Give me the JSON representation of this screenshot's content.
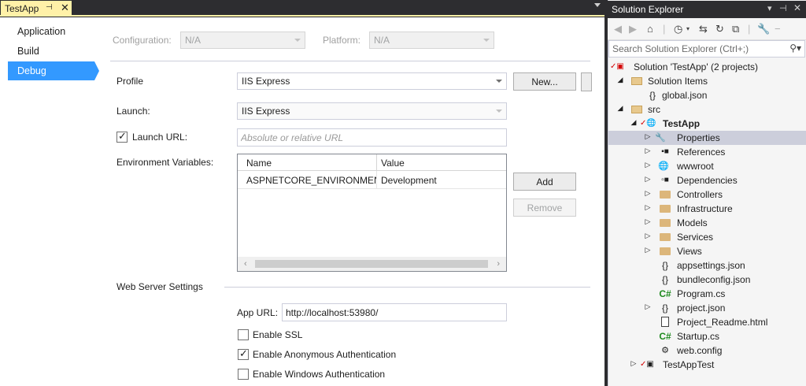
{
  "document": {
    "tab_title": "TestApp",
    "pin_glyph": "⊣",
    "close_glyph": "✕"
  },
  "nav": {
    "items": [
      {
        "label": "Application",
        "selected": false
      },
      {
        "label": "Build",
        "selected": false
      },
      {
        "label": "Debug",
        "selected": true
      }
    ]
  },
  "config": {
    "configuration_label": "Configuration:",
    "configuration_value": "N/A",
    "platform_label": "Platform:",
    "platform_value": "N/A"
  },
  "debug": {
    "profile_label": "Profile",
    "profile_value": "IIS Express",
    "new_button": "New...",
    "launch_label": "Launch:",
    "launch_value": "IIS Express",
    "launch_url_label": "Launch URL:",
    "launch_url_checked": true,
    "launch_url_placeholder": "Absolute or relative URL",
    "env_vars_label": "Environment Variables:",
    "env_columns": [
      "Name",
      "Value"
    ],
    "env_rows": [
      {
        "name": "ASPNETCORE_ENVIRONMENT",
        "value": "Development"
      }
    ],
    "add_button": "Add",
    "remove_button": "Remove",
    "web_server_label": "Web Server Settings",
    "app_url_label": "App URL:",
    "app_url_value": "http://localhost:53980/",
    "enable_ssl_label": "Enable SSL",
    "enable_ssl_checked": false,
    "anon_auth_label": "Enable Anonymous Authentication",
    "anon_auth_checked": true,
    "windows_auth_label": "Enable Windows Authentication",
    "windows_auth_checked": false
  },
  "solution_explorer": {
    "title": "Solution Explorer",
    "search_placeholder": "Search Solution Explorer (Ctrl+;)",
    "tree": [
      {
        "label": "Solution 'TestApp' (2 projects)",
        "icon": "solution-icon",
        "expanded": true
      },
      {
        "label": "Solution Items",
        "icon": "folder-icon",
        "expanded": true
      },
      {
        "label": "global.json",
        "icon": "json-file-icon"
      },
      {
        "label": "src",
        "icon": "folder-icon",
        "expanded": true
      },
      {
        "label": "TestApp",
        "icon": "web-project-icon",
        "expanded": true,
        "bold": true
      },
      {
        "label": "Properties",
        "icon": "wrench-icon",
        "expanded": false,
        "selected": true
      },
      {
        "label": "References",
        "icon": "references-icon",
        "expanded": false
      },
      {
        "label": "wwwroot",
        "icon": "globe-icon",
        "expanded": false
      },
      {
        "label": "Dependencies",
        "icon": "dependencies-icon",
        "expanded": false
      },
      {
        "label": "Controllers",
        "icon": "folder-icon",
        "expanded": false
      },
      {
        "label": "Infrastructure",
        "icon": "folder-icon",
        "expanded": false
      },
      {
        "label": "Models",
        "icon": "folder-icon",
        "expanded": false
      },
      {
        "label": "Services",
        "icon": "folder-icon",
        "expanded": false
      },
      {
        "label": "Views",
        "icon": "folder-icon",
        "expanded": false
      },
      {
        "label": "appsettings.json",
        "icon": "json-file-icon"
      },
      {
        "label": "bundleconfig.json",
        "icon": "json-file-icon"
      },
      {
        "label": "Program.cs",
        "icon": "csharp-file-icon"
      },
      {
        "label": "project.json",
        "icon": "json-file-icon",
        "expanded": false
      },
      {
        "label": "Project_Readme.html",
        "icon": "html-file-icon"
      },
      {
        "label": "Startup.cs",
        "icon": "csharp-file-icon"
      },
      {
        "label": "web.config",
        "icon": "config-file-icon"
      },
      {
        "label": "TestAppTest",
        "icon": "test-project-icon",
        "expanded": false
      }
    ]
  },
  "colors": {
    "accent": "#3399ff",
    "tab_active": "#fff1a8",
    "chrome_dark": "#2d2d30",
    "tree_selected": "#cccedb"
  }
}
